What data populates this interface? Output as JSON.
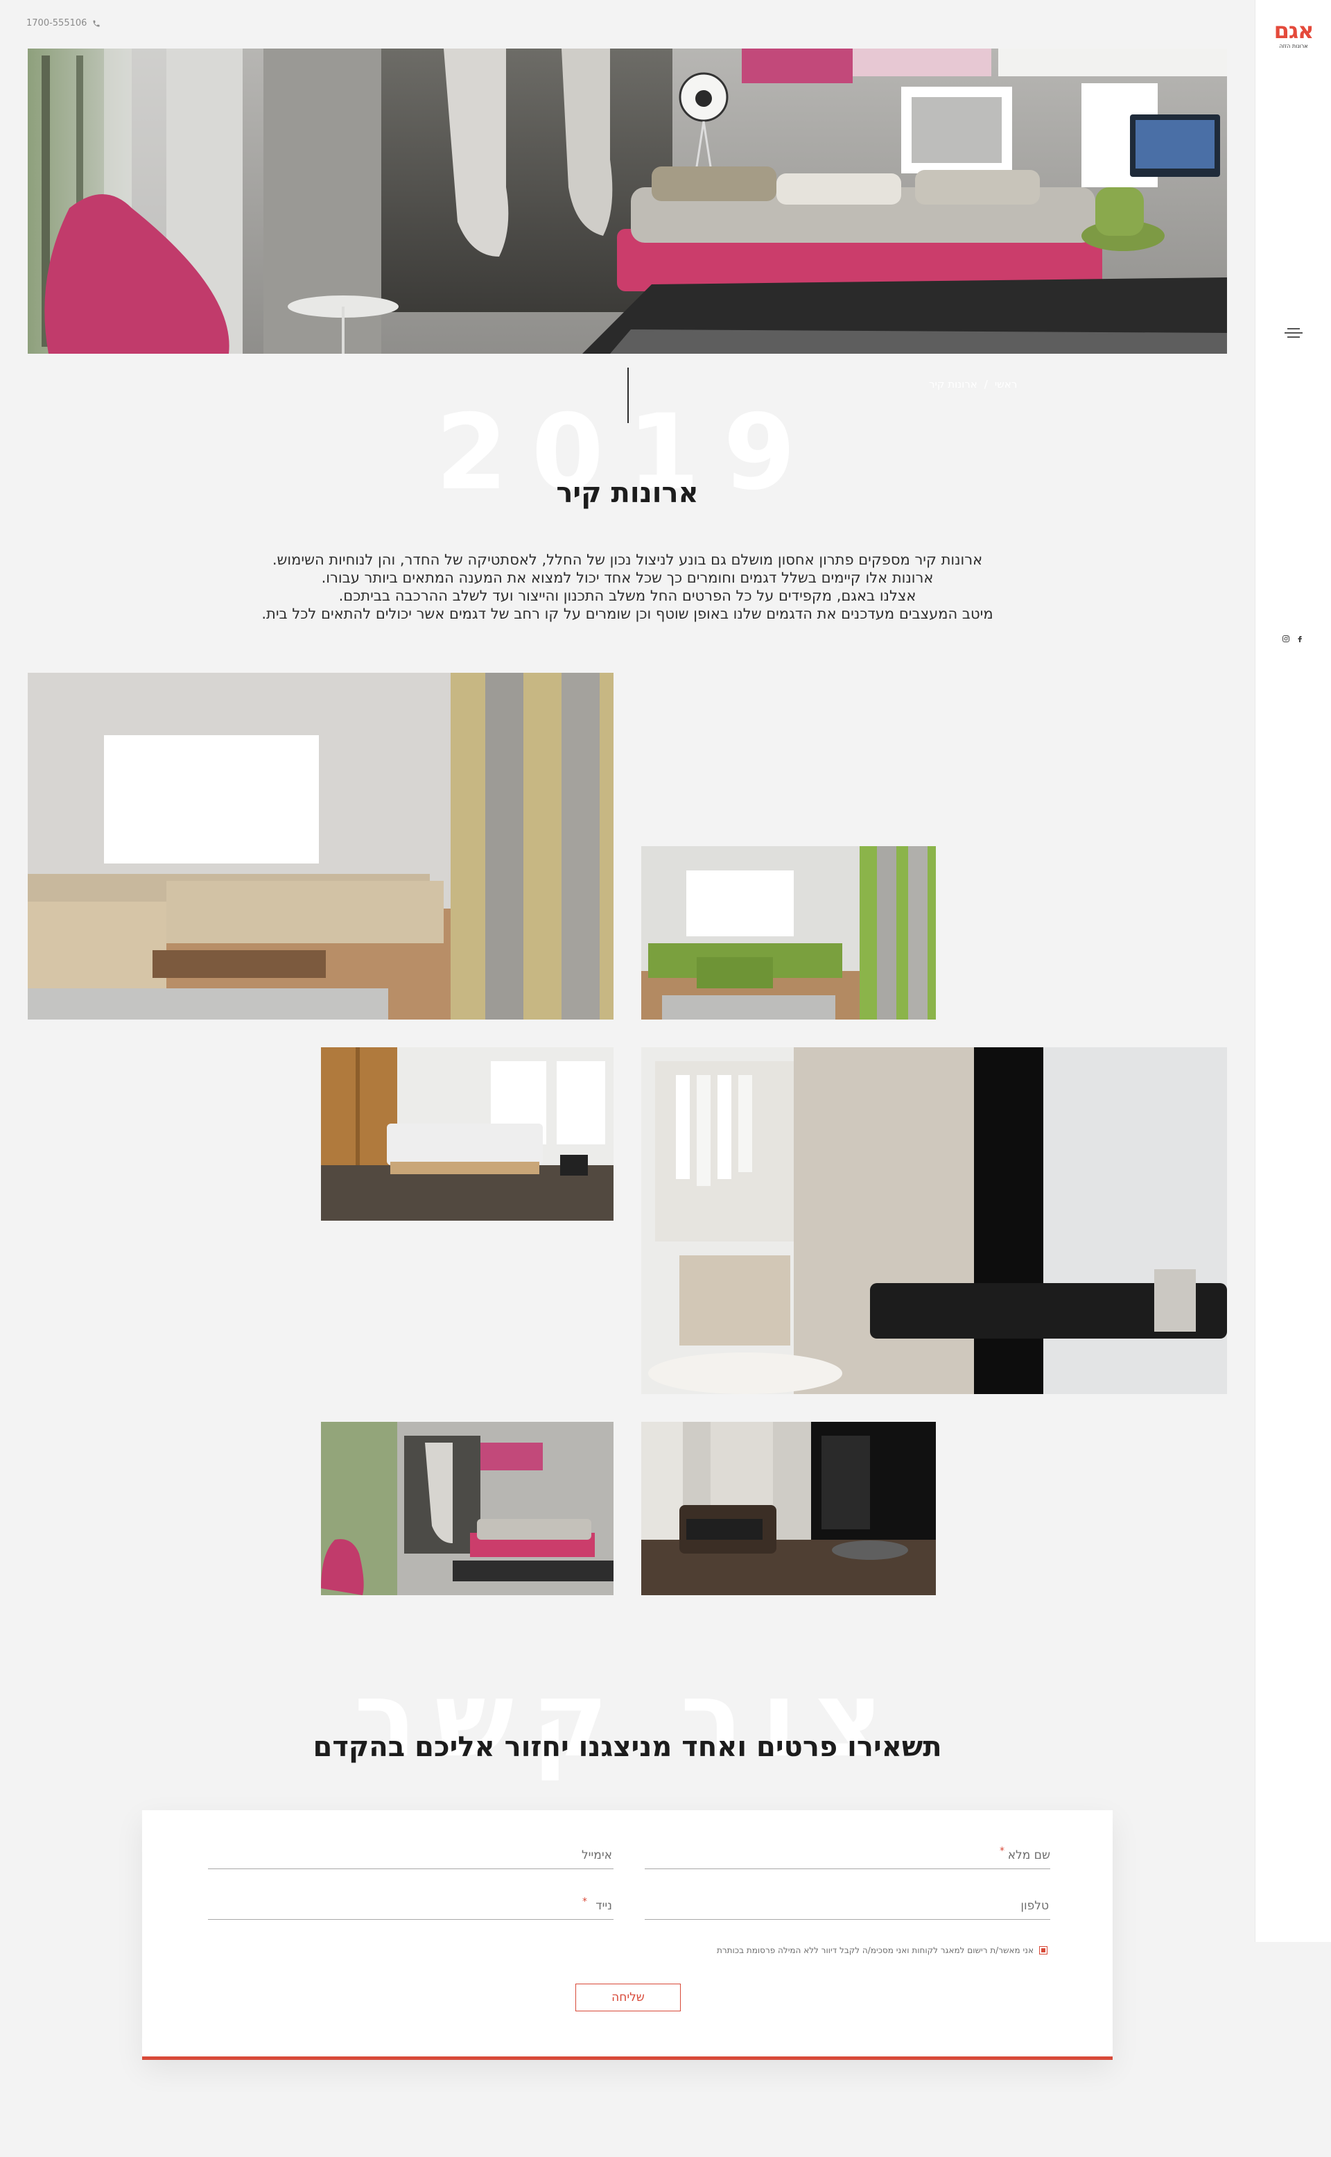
{
  "header": {
    "phone": "1700-555106",
    "phone_icon": "phone-icon"
  },
  "sidebar": {
    "logo_mark": "אגם",
    "logo_sub": "ארונות הזזה",
    "menu_icon": "hamburger-menu-icon",
    "social_icons": [
      "facebook-icon",
      "instagram-icon"
    ]
  },
  "breadcrumb": {
    "items": [
      "ארונות קיר",
      "ראשי"
    ]
  },
  "intro": {
    "year": "2019",
    "title": "ארונות קיר",
    "paragraphs": [
      "ארונות קיר מספקים פתרון אחסון מושלם גם בונע לניצול נכון של החלל, לאסתטיקה של החדר, והן לנוחיות השימוש.",
      "ארונות אלו קיימים בשלל דגמים וחומרים כך שכל אחד יכול למצוא את המענה המתאים ביותר עבורו.",
      "אצלנו באגם, מקפידים על כל הפרטים החל משלב התכנון והייצור ועד לשלב ההרכבה בביתכם.",
      "מיטב המעצבים מעדכנים את הדגמים שלנו באופן שוטף וכן שומרים על קו רחב של דגמים אשר יכולים להתאים לכל בית."
    ]
  },
  "gallery": [
    "living-room-beige-wardrobe",
    "living-room-green-wardrobe",
    "walk-in-wardrobe-bench",
    "bedroom-wood-wardrobe",
    "lounge-black-glass-wardrobe",
    "bedroom-ballet-mural"
  ],
  "contact": {
    "bg_word": "צור קשר",
    "title": "תשאירו פרטים ואחד מניצגנו יחזור אליכם בהקדם",
    "fields": {
      "name": "שם מלא",
      "email": "אימייל",
      "phone": "טלפון",
      "mobile": "נייד"
    },
    "required_mark": "*",
    "consent": "אני מאשר/ת רישום למאגר לקוחות ואני מסכימ/ה לקבל דיוור ללא המילה פרסומת בכותרת",
    "submit": "שליחה"
  },
  "colors": {
    "accent": "#d84a39",
    "background": "#f3f3f3",
    "card": "#ffffff"
  }
}
